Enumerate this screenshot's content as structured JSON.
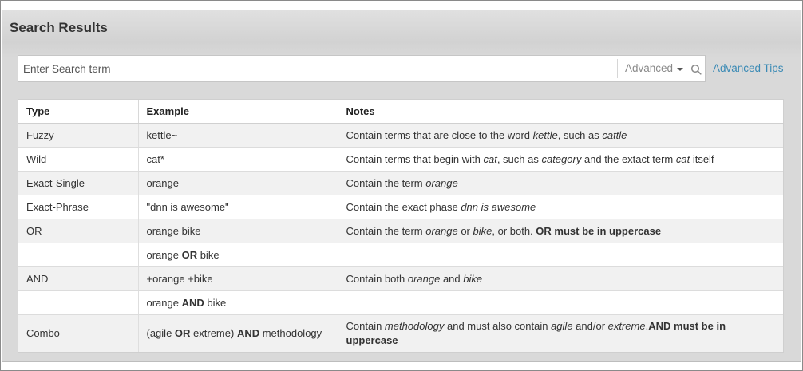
{
  "page": {
    "title": "Search Results"
  },
  "search": {
    "placeholder": "Enter Search term",
    "advanced_label": "Advanced",
    "tips_label": "Advanced Tips"
  },
  "table": {
    "headers": [
      "Type",
      "Example",
      "Notes"
    ],
    "rows": [
      {
        "type": "Fuzzy",
        "example": [
          {
            "t": "kettle~"
          }
        ],
        "notes": [
          {
            "t": "Contain terms that are close to the word "
          },
          {
            "t": "kettle",
            "s": "i"
          },
          {
            "t": ", such as "
          },
          {
            "t": "cattle",
            "s": "i"
          }
        ]
      },
      {
        "type": "Wild",
        "example": [
          {
            "t": "cat*"
          }
        ],
        "notes": [
          {
            "t": "Contain terms that begin with "
          },
          {
            "t": "cat",
            "s": "i"
          },
          {
            "t": ", such as "
          },
          {
            "t": "category",
            "s": "i"
          },
          {
            "t": " and the extact term "
          },
          {
            "t": "cat",
            "s": "i"
          },
          {
            "t": " itself"
          }
        ]
      },
      {
        "type": "Exact-Single",
        "example": [
          {
            "t": "orange"
          }
        ],
        "notes": [
          {
            "t": "Contain the term "
          },
          {
            "t": "orange",
            "s": "i"
          }
        ]
      },
      {
        "type": "Exact-Phrase",
        "example": [
          {
            "t": "\"dnn is awesome\""
          }
        ],
        "notes": [
          {
            "t": "Contain the exact phase "
          },
          {
            "t": "dnn is awesome",
            "s": "i"
          }
        ]
      },
      {
        "type": "OR",
        "example": [
          {
            "t": "orange bike"
          }
        ],
        "notes": [
          {
            "t": "Contain the term "
          },
          {
            "t": "orange",
            "s": "i"
          },
          {
            "t": " or "
          },
          {
            "t": "bike",
            "s": "i"
          },
          {
            "t": ", or both. "
          },
          {
            "t": "OR must be in uppercase",
            "s": "b"
          }
        ]
      },
      {
        "type": "",
        "example": [
          {
            "t": "orange "
          },
          {
            "t": "OR",
            "s": "b"
          },
          {
            "t": " bike"
          }
        ],
        "notes": []
      },
      {
        "type": "AND",
        "example": [
          {
            "t": "+orange +bike"
          }
        ],
        "notes": [
          {
            "t": "Contain both "
          },
          {
            "t": "orange",
            "s": "i"
          },
          {
            "t": " and "
          },
          {
            "t": "bike",
            "s": "i"
          }
        ]
      },
      {
        "type": "",
        "example": [
          {
            "t": "orange "
          },
          {
            "t": "AND",
            "s": "b"
          },
          {
            "t": " bike"
          }
        ],
        "notes": []
      },
      {
        "type": "Combo",
        "example": [
          {
            "t": "(agile "
          },
          {
            "t": "OR",
            "s": "b"
          },
          {
            "t": " extreme) "
          },
          {
            "t": "AND",
            "s": "b"
          },
          {
            "t": " methodology"
          }
        ],
        "notes": [
          {
            "t": "Contain "
          },
          {
            "t": "methodology",
            "s": "i"
          },
          {
            "t": " and must also contain "
          },
          {
            "t": "agile",
            "s": "i"
          },
          {
            "t": " and/or "
          },
          {
            "t": "extreme",
            "s": "i"
          },
          {
            "t": "."
          },
          {
            "t": "AND must be in uppercase",
            "s": "b"
          }
        ]
      }
    ]
  },
  "colors": {
    "link": "#3a8ab5",
    "row_alt": "#f1f1f1",
    "panel": "#d9d9d9"
  },
  "icons": {
    "search": "search-icon",
    "dropdown": "chevron-down-icon"
  }
}
